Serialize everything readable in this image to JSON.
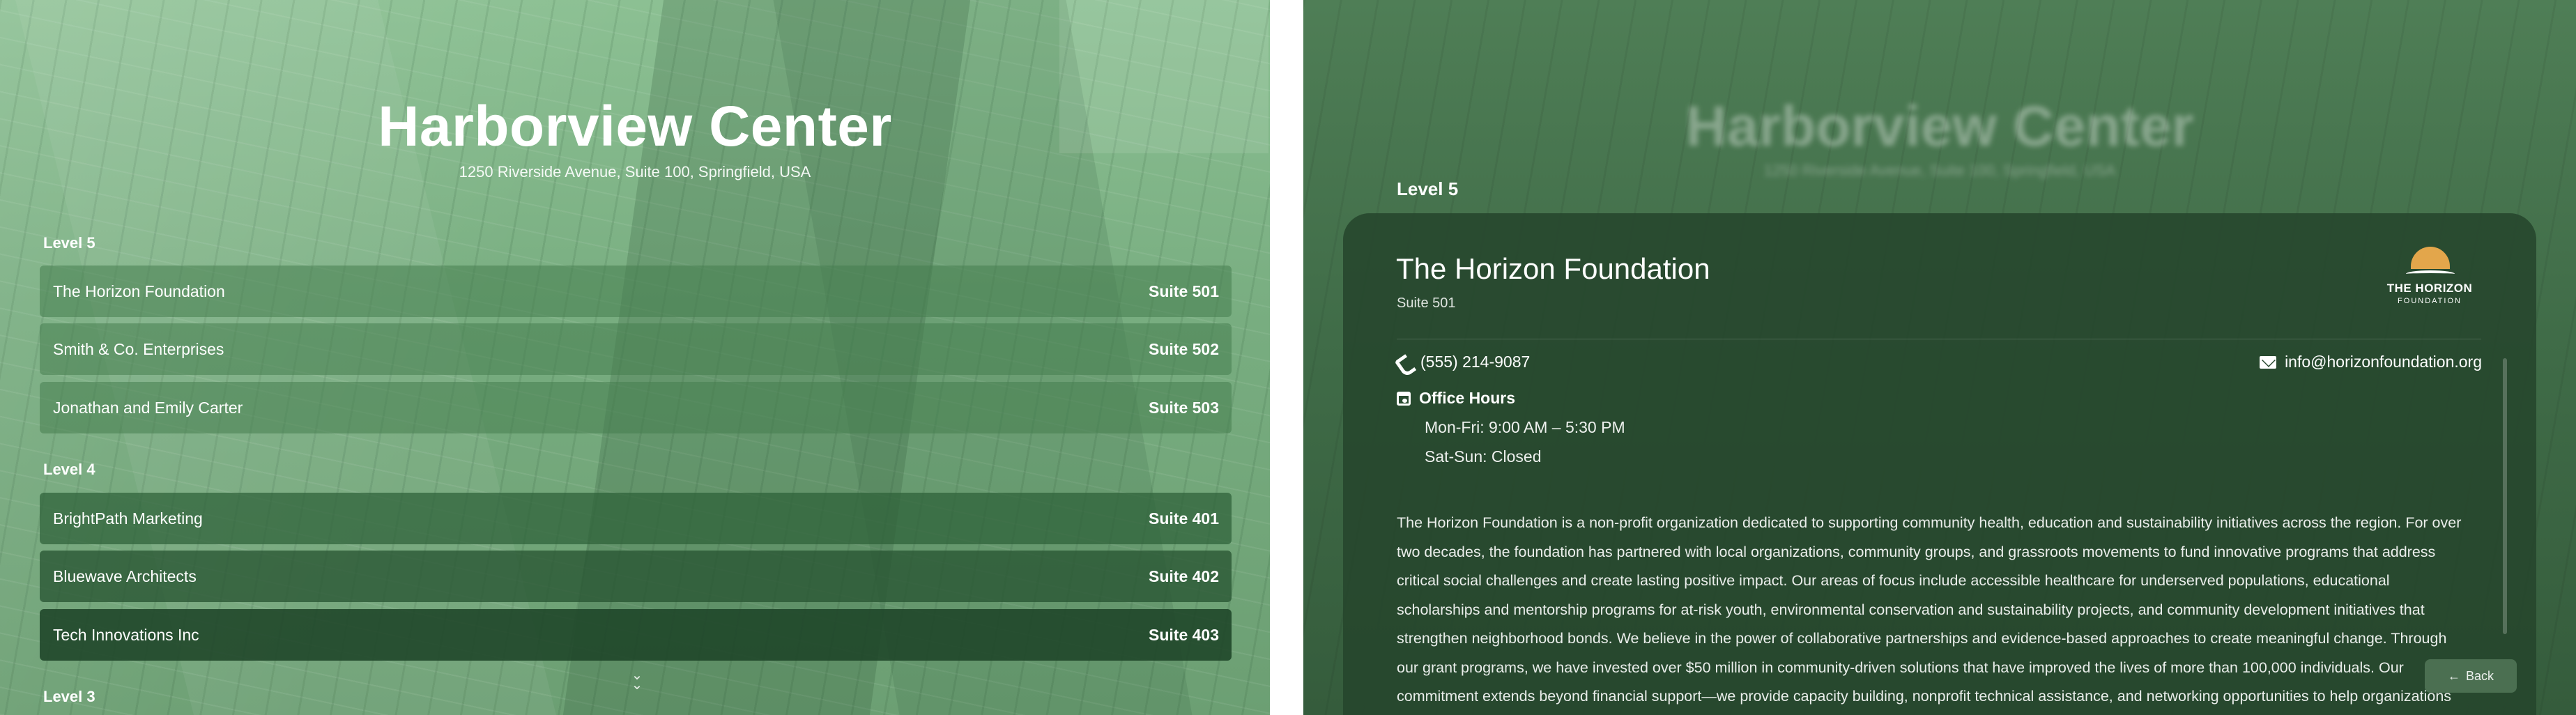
{
  "directory": {
    "title": "Harborview Center",
    "address": "1250 Riverside Avenue, Suite 100, Springfield, USA",
    "levels": [
      {
        "label": "Level 5",
        "entries": [
          {
            "name": "The Horizon Foundation",
            "suite": "Suite 501"
          },
          {
            "name": "Smith & Co. Enterprises",
            "suite": "Suite 502"
          },
          {
            "name": "Jonathan and Emily Carter",
            "suite": "Suite 503"
          }
        ]
      },
      {
        "label": "Level 4",
        "entries": [
          {
            "name": "BrightPath Marketing",
            "suite": "Suite 401"
          },
          {
            "name": "Bluewave Architects",
            "suite": "Suite 402"
          },
          {
            "name": "Tech Innovations Inc",
            "suite": "Suite 403"
          }
        ]
      },
      {
        "label": "Level 3",
        "entries": []
      }
    ],
    "scroll_hint_icon": "chevron-down-icon"
  },
  "detail": {
    "level_label": "Level 5",
    "name": "The Horizon Foundation",
    "suite": "Suite 501",
    "logo": {
      "line1": "THE HORIZON",
      "line2": "FOUNDATION",
      "sun_color": "#e3a64b"
    },
    "phone": "(555) 214-9087",
    "email": "info@horizonfoundation.org",
    "office_hours_label": "Office Hours",
    "hours": [
      "Mon-Fri: 9:00 AM – 5:30 PM",
      "Sat-Sun: Closed"
    ],
    "description": "The Horizon Foundation is a non-profit organization dedicated to supporting community health, education and sustainability initiatives across the region. For over two decades, the foundation has partnered with local organizations, community groups, and grassroots movements to fund innovative programs that address critical social challenges and create lasting positive impact. Our areas of focus include accessible healthcare for underserved populations, educational scholarships and mentorship programs for at-risk youth, environmental conservation and sustainability projects, and community development initiatives that strengthen neighborhood bonds. We believe in the power of collaborative partnerships and evidence-based approaches to create meaningful change. Through our grant programs, we have invested over $50 million in community-driven solutions that have improved the lives of more than 100,000 individuals. Our commitment extends beyond financial support—we provide capacity building, nonprofit technical assistance, and networking opportunities to help organizations maximize their impact and achieve long-term success.",
    "back_label": "Back",
    "icons": {
      "phone": "phone-icon",
      "email": "envelope-icon",
      "hours": "calendar-icon",
      "back": "arrow-left-icon"
    }
  },
  "colors": {
    "accent": "#e3a64b",
    "overlay_green": "#3f6b47",
    "text": "#ffffff"
  }
}
